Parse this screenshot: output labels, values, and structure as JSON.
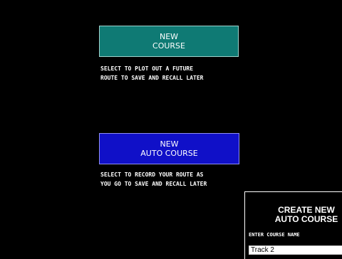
{
  "menu": {
    "new_course": {
      "line1": "NEW",
      "line2": "COURSE",
      "description_line1": "SELECT TO PLOT OUT A FUTURE",
      "description_line2": "ROUTE TO SAVE AND RECALL LATER",
      "color": "#0f7a74"
    },
    "new_auto_course": {
      "line1": "NEW",
      "line2": "AUTO COURSE",
      "description_line1": "SELECT TO RECORD YOUR ROUTE AS",
      "description_line2": "YOU GO TO SAVE AND RECALL LATER",
      "color": "#1010c8"
    }
  },
  "dialog": {
    "title_line1": "CREATE NEW",
    "title_line2": "AUTO COURSE",
    "field_label": "ENTER COURSE NAME",
    "field_value": "Track 2"
  }
}
